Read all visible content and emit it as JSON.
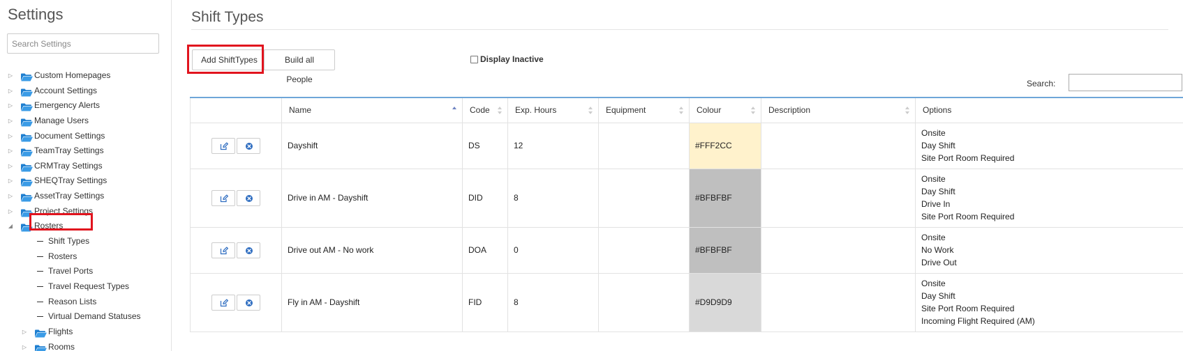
{
  "sidebar": {
    "title": "Settings",
    "search_placeholder": "Search Settings",
    "items": [
      {
        "label": "Custom Homepages",
        "type": "folder",
        "expanded": false
      },
      {
        "label": "Account Settings",
        "type": "folder",
        "expanded": false
      },
      {
        "label": "Emergency Alerts",
        "type": "folder",
        "expanded": false
      },
      {
        "label": "Manage Users",
        "type": "folder",
        "expanded": false
      },
      {
        "label": "Document Settings",
        "type": "folder",
        "expanded": false
      },
      {
        "label": "TeamTray Settings",
        "type": "folder",
        "expanded": false
      },
      {
        "label": "CRMTray Settings",
        "type": "folder",
        "expanded": false
      },
      {
        "label": "SHEQTray Settings",
        "type": "folder",
        "expanded": false
      },
      {
        "label": "AssetTray Settings",
        "type": "folder",
        "expanded": false
      },
      {
        "label": "Project Settings",
        "type": "folder",
        "expanded": false
      },
      {
        "label": "Rosters",
        "type": "folder",
        "expanded": true
      },
      {
        "label": "Shift Types",
        "type": "leaf",
        "selected": true
      },
      {
        "label": "Rosters",
        "type": "leaf"
      },
      {
        "label": "Travel Ports",
        "type": "leaf"
      },
      {
        "label": "Travel Request Types",
        "type": "leaf"
      },
      {
        "label": "Reason Lists",
        "type": "leaf"
      },
      {
        "label": "Virtual Demand Statuses",
        "type": "leaf"
      },
      {
        "label": "Flights",
        "type": "subfolder",
        "expanded": false
      },
      {
        "label": "Rooms",
        "type": "subfolder",
        "expanded": false
      }
    ]
  },
  "main": {
    "title": "Shift Types",
    "buttons": {
      "add": "Add ShiftTypes",
      "build": "Build all People"
    },
    "display_inactive": "Display Inactive",
    "search_label": "Search:",
    "columns": [
      "",
      "Name",
      "Code",
      "Exp. Hours",
      "Equipment",
      "Colour",
      "Description",
      "Options"
    ],
    "rows": [
      {
        "name": "Dayshift",
        "code": "DS",
        "hours": "12",
        "equipment": "",
        "colour": "#FFF2CC",
        "description": "",
        "options": [
          "Onsite",
          "Day Shift",
          "Site Port Room Required"
        ]
      },
      {
        "name": "Drive in AM - Dayshift",
        "code": "DID",
        "hours": "8",
        "equipment": "",
        "colour": "#BFBFBF",
        "description": "",
        "options": [
          "Onsite",
          "Day Shift",
          "Drive In",
          "Site Port Room Required"
        ]
      },
      {
        "name": "Drive out AM - No work",
        "code": "DOA",
        "hours": "0",
        "equipment": "",
        "colour": "#BFBFBF",
        "description": "",
        "options": [
          "Onsite",
          "No Work",
          "Drive Out"
        ]
      },
      {
        "name": "Fly in AM - Dayshift",
        "code": "FID",
        "hours": "8",
        "equipment": "",
        "colour": "#D9D9D9",
        "description": "",
        "options": [
          "Onsite",
          "Day Shift",
          "Site Port Room Required",
          "Incoming Flight Required (AM)"
        ]
      }
    ]
  },
  "colors": {
    "highlight": "#e1141e",
    "folder": "#2f8fd8",
    "table_top_border": "#6ea6d8",
    "icon_blue": "#2d6cc0"
  }
}
